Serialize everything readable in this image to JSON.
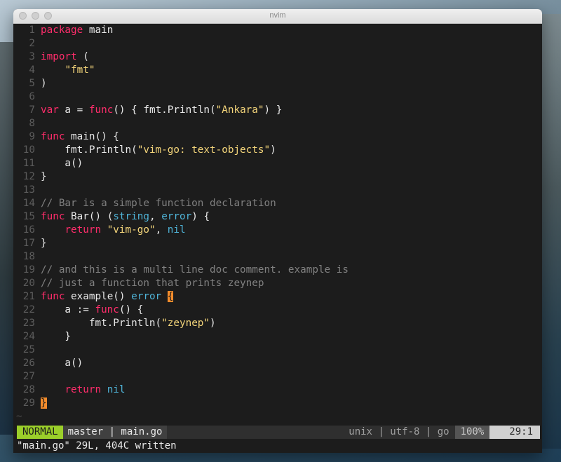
{
  "window": {
    "title": "nvim"
  },
  "editor": {
    "lines": [
      {
        "n": "1",
        "t": [
          {
            "c": "kw",
            "v": "package"
          },
          {
            "v": " main"
          }
        ]
      },
      {
        "n": "2",
        "t": []
      },
      {
        "n": "3",
        "t": [
          {
            "c": "kw",
            "v": "import"
          },
          {
            "v": " ("
          }
        ]
      },
      {
        "n": "4",
        "t": [
          {
            "v": "    "
          },
          {
            "c": "str",
            "v": "\"fmt\""
          }
        ]
      },
      {
        "n": "5",
        "t": [
          {
            "v": ")"
          }
        ]
      },
      {
        "n": "6",
        "t": []
      },
      {
        "n": "7",
        "t": [
          {
            "c": "kw",
            "v": "var"
          },
          {
            "v": " a = "
          },
          {
            "c": "kw",
            "v": "func"
          },
          {
            "v": "() { fmt.Println("
          },
          {
            "c": "str",
            "v": "\"Ankara\""
          },
          {
            "v": ") }"
          }
        ]
      },
      {
        "n": "8",
        "t": []
      },
      {
        "n": "9",
        "t": [
          {
            "c": "kw",
            "v": "func"
          },
          {
            "v": " main() {"
          }
        ]
      },
      {
        "n": "10",
        "t": [
          {
            "v": "    fmt.Println("
          },
          {
            "c": "str",
            "v": "\"vim-go: text-objects\""
          },
          {
            "v": ")"
          }
        ]
      },
      {
        "n": "11",
        "t": [
          {
            "v": "    a()"
          }
        ]
      },
      {
        "n": "12",
        "t": [
          {
            "v": "}"
          }
        ]
      },
      {
        "n": "13",
        "t": []
      },
      {
        "n": "14",
        "t": [
          {
            "c": "cmt",
            "v": "// Bar is a simple function declaration"
          }
        ]
      },
      {
        "n": "15",
        "t": [
          {
            "c": "kw",
            "v": "func"
          },
          {
            "v": " Bar() ("
          },
          {
            "c": "ty",
            "v": "string"
          },
          {
            "v": ", "
          },
          {
            "c": "ty",
            "v": "error"
          },
          {
            "v": ") {"
          }
        ]
      },
      {
        "n": "16",
        "t": [
          {
            "v": "    "
          },
          {
            "c": "kw",
            "v": "return"
          },
          {
            "v": " "
          },
          {
            "c": "str",
            "v": "\"vim-go\""
          },
          {
            "v": ", "
          },
          {
            "c": "ty",
            "v": "nil"
          }
        ]
      },
      {
        "n": "17",
        "t": [
          {
            "v": "}"
          }
        ]
      },
      {
        "n": "18",
        "t": []
      },
      {
        "n": "19",
        "t": [
          {
            "c": "cmt",
            "v": "// and this is a multi line doc comment. example is"
          }
        ]
      },
      {
        "n": "20",
        "t": [
          {
            "c": "cmt",
            "v": "// just a function that prints zeynep"
          }
        ]
      },
      {
        "n": "21",
        "t": [
          {
            "c": "kw",
            "v": "func"
          },
          {
            "v": " example() "
          },
          {
            "c": "ty",
            "v": "error"
          },
          {
            "v": " "
          },
          {
            "c": "cursor",
            "v": "{"
          }
        ]
      },
      {
        "n": "22",
        "t": [
          {
            "v": "    a := "
          },
          {
            "c": "kw",
            "v": "func"
          },
          {
            "v": "() {"
          }
        ]
      },
      {
        "n": "23",
        "t": [
          {
            "v": "        fmt.Println("
          },
          {
            "c": "str",
            "v": "\"zeynep\""
          },
          {
            "v": ")"
          }
        ]
      },
      {
        "n": "24",
        "t": [
          {
            "v": "    }"
          }
        ]
      },
      {
        "n": "25",
        "t": []
      },
      {
        "n": "26",
        "t": [
          {
            "v": "    a()"
          }
        ]
      },
      {
        "n": "27",
        "t": []
      },
      {
        "n": "28",
        "t": [
          {
            "v": "    "
          },
          {
            "c": "kw",
            "v": "return"
          },
          {
            "v": " "
          },
          {
            "c": "ty",
            "v": "nil"
          }
        ]
      },
      {
        "n": "29",
        "t": [
          {
            "c": "cursor",
            "v": "}"
          }
        ]
      }
    ],
    "tilde": "~"
  },
  "statusline": {
    "mode": "NORMAL",
    "branch_file": "master | main.go",
    "file_info": "unix | utf-8 | go",
    "percent": "100%",
    "position": "29:1"
  },
  "message": "\"main.go\" 29L, 404C written",
  "colors": {
    "keyword": "#ff2d6b",
    "type": "#4fb4d8",
    "string": "#f5d67b",
    "comment": "#808080",
    "cursor": "#f38c2c",
    "mode_bg": "#9bcf2a"
  }
}
